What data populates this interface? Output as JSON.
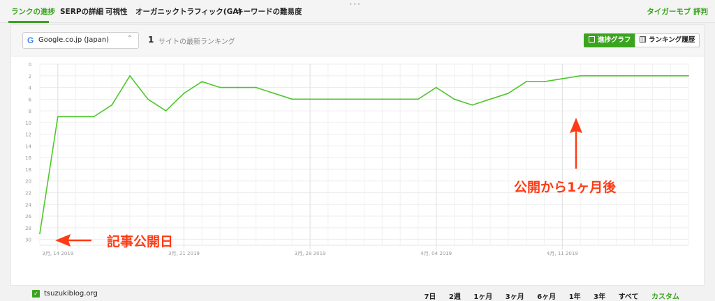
{
  "nav": {
    "tabs": [
      {
        "label": "ランクの進捗",
        "active": true
      },
      {
        "label": "SERPの詳細",
        "active": false
      },
      {
        "label": "可視性",
        "active": false
      },
      {
        "label": "オーガニックトラフィック(GA)",
        "active": false
      },
      {
        "label": "キーワードの難易度",
        "active": false
      }
    ],
    "review_link": "タイガーモブ 評判",
    "grip": "•••"
  },
  "toolbar": {
    "engine": "Google.co.jp (Japan)",
    "site_count": "1",
    "site_count_label": "サイトの最新ランキング",
    "progress_button": "進捗グラフ",
    "history_button": "ランキング履歴"
  },
  "chart_data": {
    "type": "line",
    "title": "",
    "xlabel": "",
    "ylabel": "",
    "y_inverted": true,
    "ylim": [
      0,
      31
    ],
    "yticks": [
      0,
      2,
      4,
      6,
      8,
      10,
      12,
      14,
      16,
      18,
      20,
      22,
      24,
      26,
      28,
      30
    ],
    "xticks": [
      "3月, 14 2019",
      "3月, 21 2019",
      "3月, 28 2019",
      "4月, 04 2019",
      "4月, 11 2019"
    ],
    "grid": true,
    "legend_position": "bottom-left",
    "line_color": "#4fc62c",
    "series": [
      {
        "name": "tsuzukiblog.org",
        "x": [
          "2019-03-13",
          "2019-03-14",
          "2019-03-15",
          "2019-03-16",
          "2019-03-17",
          "2019-03-18",
          "2019-03-19",
          "2019-03-20",
          "2019-03-21",
          "2019-03-22",
          "2019-03-23",
          "2019-03-24",
          "2019-03-25",
          "2019-03-26",
          "2019-03-27",
          "2019-03-28",
          "2019-03-29",
          "2019-03-30",
          "2019-03-31",
          "2019-04-01",
          "2019-04-02",
          "2019-04-03",
          "2019-04-04",
          "2019-04-05",
          "2019-04-06",
          "2019-04-07",
          "2019-04-08",
          "2019-04-09",
          "2019-04-10",
          "2019-04-11",
          "2019-04-12",
          "2019-04-13",
          "2019-04-14",
          "2019-04-15",
          "2019-04-16",
          "2019-04-17",
          "2019-04-18"
        ],
        "y": [
          29,
          9,
          9,
          9,
          7,
          2,
          6,
          8,
          5,
          3,
          4,
          4,
          4,
          5,
          6,
          6,
          6,
          6,
          6,
          6,
          6,
          6,
          4,
          6,
          7,
          6,
          5,
          3,
          3,
          2.5,
          2,
          2,
          2,
          2,
          2,
          2,
          2
        ]
      }
    ]
  },
  "annotations": {
    "publish_label": "記事公開日",
    "month_later_label": "公開から1ヶ月後",
    "color": "#ff3b14"
  },
  "legend": {
    "label": "tsuzukiblog.org",
    "check": "✓",
    "color": "#3aa41e"
  },
  "ranges": [
    {
      "label": "7日",
      "active": false
    },
    {
      "label": "2週",
      "active": false
    },
    {
      "label": "1ヶ月",
      "active": false
    },
    {
      "label": "3ヶ月",
      "active": false
    },
    {
      "label": "6ヶ月",
      "active": false
    },
    {
      "label": "1年",
      "active": false
    },
    {
      "label": "3年",
      "active": false
    },
    {
      "label": "すべて",
      "active": false
    },
    {
      "label": "カスタム",
      "active": true
    }
  ]
}
